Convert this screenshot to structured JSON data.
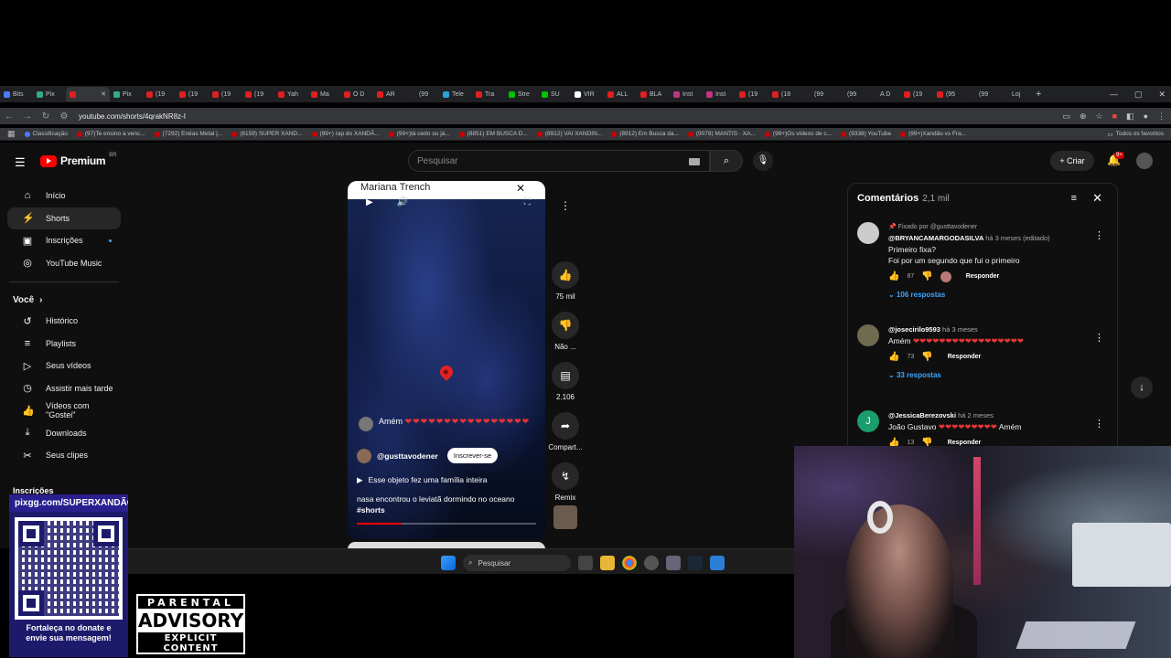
{
  "browser": {
    "tabs": [
      "Bits",
      "Pix",
      "",
      "Pix",
      "(19",
      "(19",
      "(19",
      "(19",
      "Yah",
      "Ma",
      "O D",
      "AR",
      "(99",
      "Tele",
      "Tra",
      "Stre",
      "SU",
      "VIR",
      "ALL",
      "BLA",
      "Inst",
      "Inst",
      "(19",
      "(18",
      "(99",
      "(99",
      "A D",
      "(19",
      "(95",
      "(99",
      "Loj"
    ],
    "url": "youtube.com/shorts/4qrakNR8z-I",
    "bookmarks": [
      "Classificação",
      "(97)Te ensino a venc...",
      "(7292) Enéas Metal |...",
      "(8159) SUPER XAND...",
      "(99+) rap do XANDÃ...",
      "(99+)tá cedo ou já...",
      "(8851) EM BUSCA D...",
      "(8912) VAI XANDIN...",
      "(8912) Em Busca da...",
      "(9078) MANTIS · XA...",
      "(99+)Os vídeos de c...",
      "(9338) YouTube",
      "(99+)Xandão vs Fra..."
    ],
    "bookmarks_right": "Todos os favoritos"
  },
  "header": {
    "logo": "Premium",
    "region": "BR",
    "search_placeholder": "Pesquisar",
    "create": "Criar",
    "notif_badge": "9+"
  },
  "sidebar": {
    "items": [
      {
        "label": "Início",
        "icon": "⌂"
      },
      {
        "label": "Shorts",
        "icon": "⚡"
      },
      {
        "label": "Inscrições",
        "icon": "▣"
      },
      {
        "label": "YouTube Music",
        "icon": "◎"
      }
    ],
    "you_header": "Você",
    "you_items": [
      {
        "label": "Histórico",
        "icon": "↺"
      },
      {
        "label": "Playlists",
        "icon": "≡"
      },
      {
        "label": "Seus vídeos",
        "icon": "▷"
      },
      {
        "label": "Assistir mais tarde",
        "icon": "◷"
      },
      {
        "label": "Vídeos com \"Gostei\"",
        "icon": "👍"
      },
      {
        "label": "Downloads",
        "icon": "⤓"
      },
      {
        "label": "Seus clipes",
        "icon": "✂"
      }
    ],
    "subs_header": "Inscrições"
  },
  "short": {
    "title": "Mariana Trench",
    "overlay_user_comment": "Amém",
    "overlay_hearts": "❤❤❤❤❤❤❤❤❤❤❤❤❤❤❤❤",
    "channel": "@gusttavodener",
    "subscribe": "Inscrever-se",
    "description": "Esse objeto fez uma família inteira",
    "caption": "nasa encontrou o leviatã dormindo no oceano",
    "hashtag": "#shorts",
    "progress": 0.25
  },
  "actions": {
    "likes": "75 mil",
    "dislike": "Não ...",
    "comments": "2.106",
    "share": "Compart...",
    "remix": "Remix"
  },
  "comments": {
    "title": "Comentários",
    "count": "2,1 mil",
    "items": [
      {
        "pinned": "Fixado por @gusttavodener",
        "author": "@BRYANCAMARGODASILVA",
        "time": "há 3 meses (editado)",
        "text": [
          "Primeiro fixa?",
          "Foi por um segundo que fui o primeiro"
        ],
        "likes": "87",
        "reply": "Responder",
        "replies": "106 respostas"
      },
      {
        "author": "@josecirilo9593",
        "time": "há 3 meses",
        "text_prefix": "Amém",
        "hearts": "❤❤❤❤❤❤❤❤❤❤❤❤❤❤❤❤❤",
        "likes": "73",
        "reply": "Responder",
        "replies": "33 respostas"
      },
      {
        "author": "@JessicaBerezovski",
        "time": "há 2 meses",
        "text_prefix": "João Gustavo",
        "hearts": "❤❤❤❤❤❤❤❤❤",
        "text_suffix": "Amém",
        "likes": "13",
        "reply": "Responder",
        "avatar_letter": "J"
      }
    ]
  },
  "taskbar": {
    "search": "Pesquisar"
  },
  "overlays": {
    "qr_title": "pixgg.com/SUPERXANDÃO",
    "qr_text": [
      "Fortaleça no donate e",
      "envie sua mensagem!"
    ],
    "advisory": [
      "PARENTAL",
      "ADVISORY",
      "EXPLICIT CONTENT"
    ],
    "sidebar_cut": "Inscrições"
  },
  "colors": {
    "accent": "#ff0000",
    "link": "#3ea6ff",
    "heart": "#e23636"
  }
}
